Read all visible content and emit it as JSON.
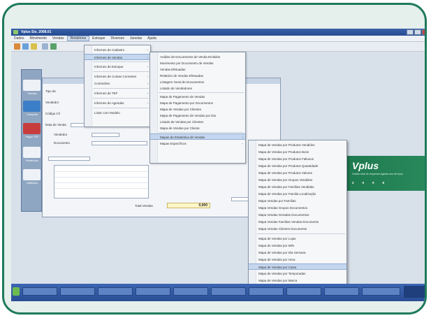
{
  "app": {
    "title": "Vplus Sis. 2008.01"
  },
  "menubar": [
    "Dados",
    "Movimento",
    "Vendas",
    "Relatórios",
    "Estoque",
    "Diversos",
    "Janelas",
    "Ajuda"
  ],
  "menu1": {
    "items": [
      "Informes de Cadastro",
      "Informes de Vendas",
      "Informes de Estoque",
      "Informes de Contas Correntes",
      "Comissões",
      "Informes de TEF",
      "Informes de Agendas",
      "Listar com Modelo"
    ],
    "highlighted_index": 1
  },
  "menu2": {
    "items": [
      "Análise de Documentos de Venda Emitidos",
      "Movimento por Documento de Vendas",
      "Vendas Efetuadas",
      "Relatório de Vendas Efetuadas",
      "Listagem Geral de Documentos",
      "Listado de Vendedores",
      "Mapa de Pagamento de Vendas",
      "Mapa de Pagamento por Documentos",
      "Mapa de Vendas por Clientes",
      "Mapa de Pagamento de Vendas por Dia",
      "Listado de Vendas por Clientes",
      "Mapa de Vendas por Cliente",
      "Mapas de Estatística de Vendas",
      "Mapas Específicos"
    ],
    "highlighted_index": 12
  },
  "menu3": {
    "items": [
      "Mapa de Vendas por Produtos Vendidos",
      "Mapa de Vendas por Produtos Bons",
      "Mapa de Vendas por Produtos Faltosos",
      "Mapa de Vendas por Produtos Quantidade",
      "Mapa de Vendas por Produtos Valores",
      "Mapa de Vendas por Grupos Vendidos",
      "Mapa de Vendas por Famílias Vendidas",
      "Mapa de Vendas por Familia Localização",
      "Mapa Vendas por Famílias",
      "Mapa Vendas Grupos Documentos",
      "Mapa Vendas Geradas Documentos",
      "Mapa Vendas Famílias Vendas Documento",
      "Mapa Vendas Clientes Documento",
      "Mapa de Vendas por Lojas",
      "Mapa de Vendas por Mês",
      "Mapa de Vendas por Dia Semana",
      "Mapa de Vendas por Hora",
      "Mapa de Vendas por Caixa",
      "Mapa de Vendas por Temporadas",
      "Mapa de Vendas por Marca"
    ],
    "highlighted_index": 17
  },
  "left_panel": {
    "items": [
      "Vendas",
      "Compras",
      "Pagar TEF",
      "Relatórios",
      "Utilitários"
    ]
  },
  "inner_window": {
    "total_value": "0,000",
    "total_label": "Total Vendas",
    "fields": [
      "Tipo de",
      "Vendedor",
      "Código Cli",
      "Data de Venda",
      "Vendedor",
      "Documento"
    ]
  },
  "brand": {
    "logo": "Vplus",
    "tagline": "Gestão total de empresas ligadas aos serviços",
    "year": "2008"
  },
  "colors": {
    "frame": "#1e7a5a",
    "brand": "#1e7a4f",
    "highlight": "#c5d7ee",
    "taskbar": "#2a4e94"
  }
}
